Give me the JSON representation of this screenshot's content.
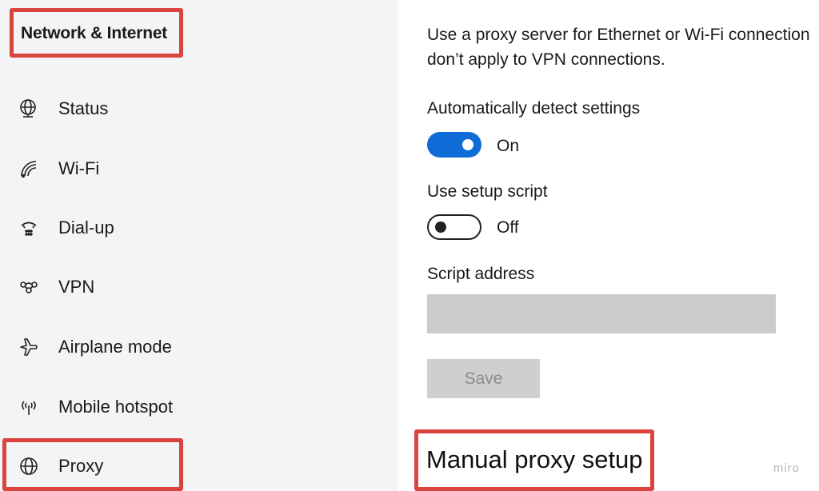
{
  "sidebar": {
    "title": "Network & Internet",
    "items": [
      {
        "label": "Status",
        "icon": "globe-status-icon"
      },
      {
        "label": "Wi-Fi",
        "icon": "wifi-icon"
      },
      {
        "label": "Dial-up",
        "icon": "dialup-icon"
      },
      {
        "label": "VPN",
        "icon": "vpn-icon"
      },
      {
        "label": "Airplane mode",
        "icon": "airplane-icon"
      },
      {
        "label": "Mobile hotspot",
        "icon": "hotspot-icon"
      },
      {
        "label": "Proxy",
        "icon": "globe-icon"
      }
    ],
    "selected": "Proxy"
  },
  "main": {
    "description_line1": "Use a proxy server for Ethernet or Wi-Fi connection",
    "description_line2": "don’t apply to VPN connections.",
    "auto_detect": {
      "label": "Automatically detect settings",
      "state": "On",
      "on": true
    },
    "setup_script": {
      "label": "Use setup script",
      "state": "Off",
      "on": false
    },
    "script_address": {
      "label": "Script address",
      "value": ""
    },
    "save_label": "Save",
    "section_heading": "Manual proxy setup"
  },
  "watermark": "miro",
  "colors": {
    "accent": "#0f6cd6",
    "highlight": "#d9443f",
    "sidebar_bg": "#f2f4f6"
  }
}
